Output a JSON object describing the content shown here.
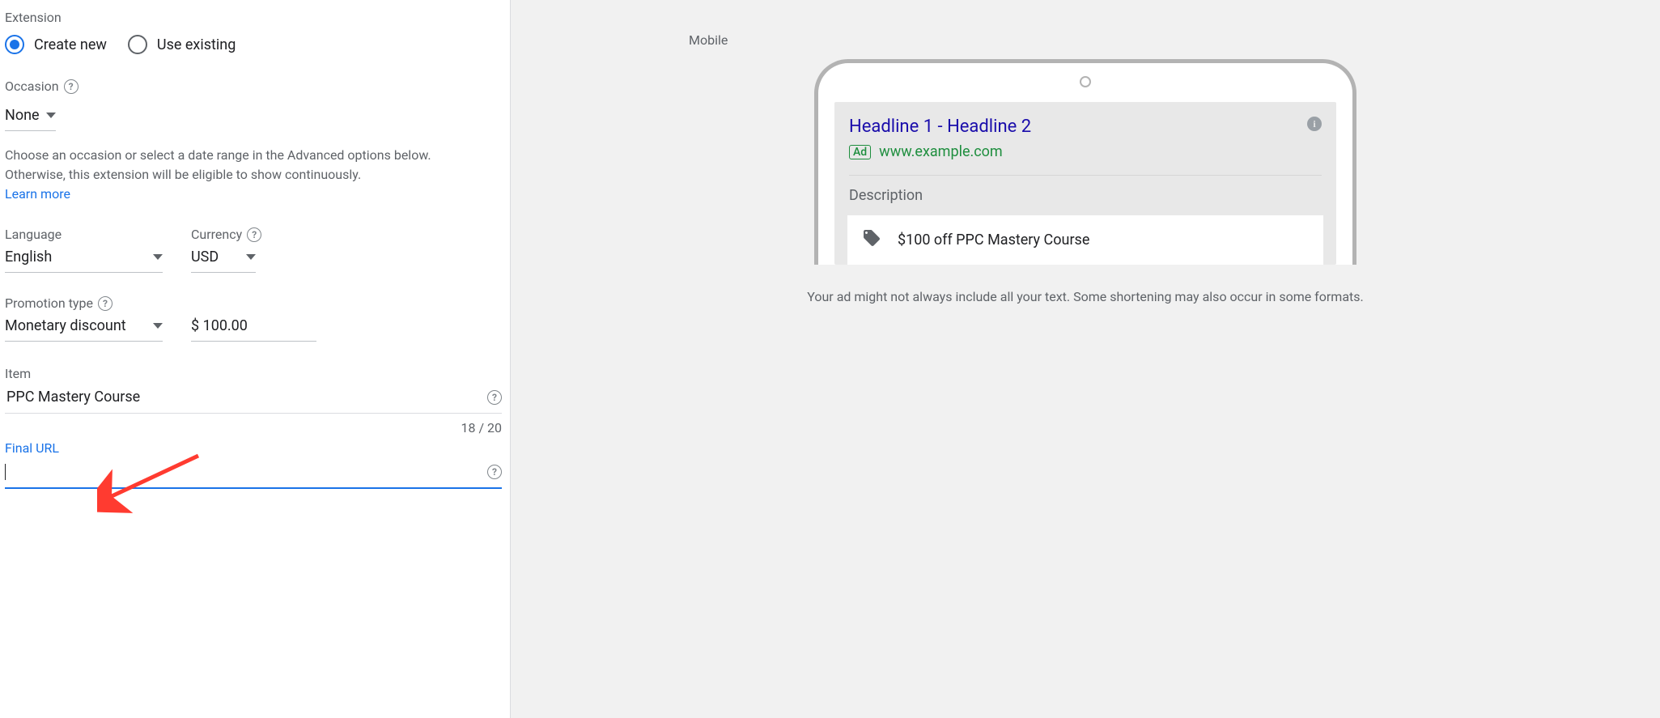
{
  "left": {
    "extension_label": "Extension",
    "radio_create": "Create new",
    "radio_use_existing": "Use existing",
    "occasion_label": "Occasion",
    "occasion_value": "None",
    "occasion_helper": "Choose an occasion or select a date range in the Advanced options below. Otherwise, this extension will be eligible to show continuously.",
    "learn_more": "Learn more",
    "language_label": "Language",
    "language_value": "English",
    "currency_label": "Currency",
    "currency_value": "USD",
    "promo_type_label": "Promotion type",
    "promo_type_value": "Monetary discount",
    "promo_amount": "$ 100.00",
    "item_label": "Item",
    "item_value": "PPC Mastery Course",
    "item_counter": "18 / 20",
    "final_url_label": "Final URL",
    "final_url_value": ""
  },
  "preview": {
    "device_label": "Mobile",
    "headline": "Headline 1 - Headline 2",
    "ad_badge": "Ad",
    "display_url": "www.example.com",
    "description": "Description",
    "promo_text": "$100 off PPC Mastery Course",
    "disclaimer": "Your ad might not always include all your text. Some shortening may also occur in some formats."
  }
}
